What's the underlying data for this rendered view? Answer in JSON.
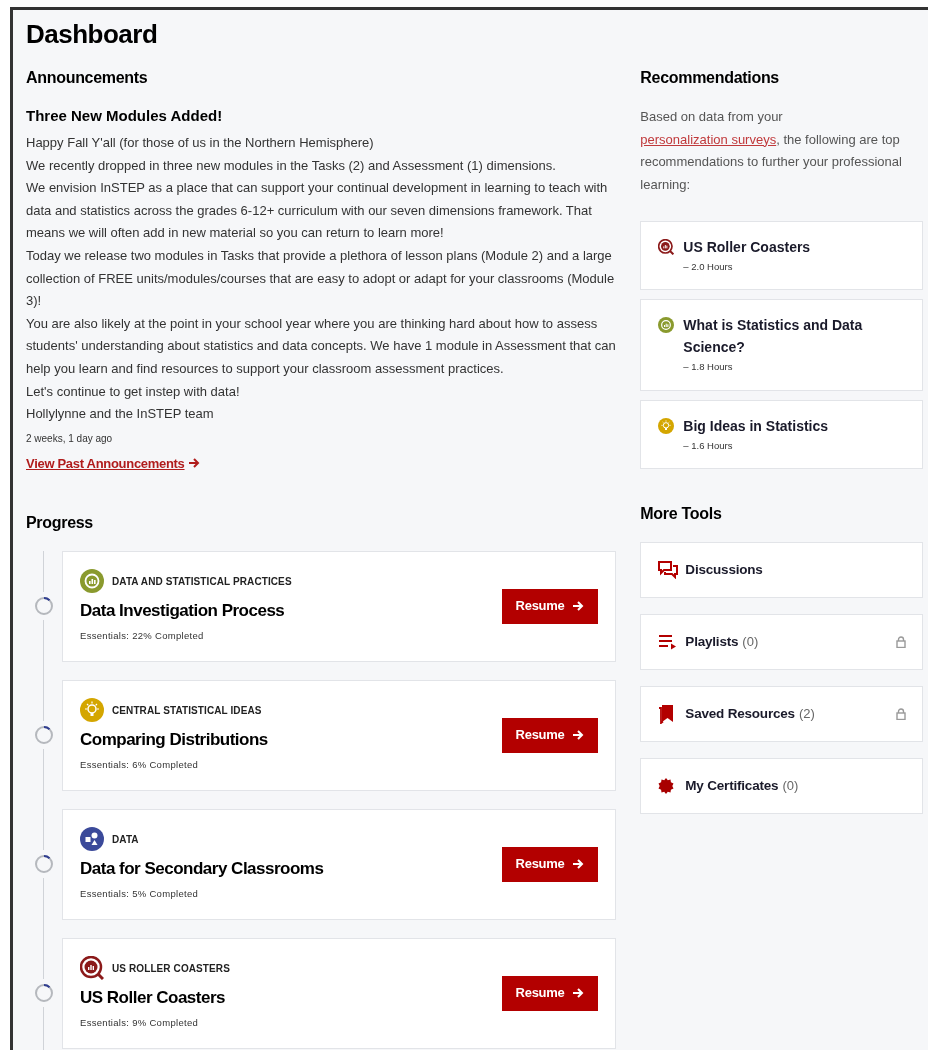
{
  "page_title": "Dashboard",
  "announcements": {
    "heading": "Announcements",
    "title": "Three New Modules Added!",
    "lines": [
      "Happy Fall Y'all (for those of us in the Northern Hemisphere)",
      "We recently dropped in three new modules in the Tasks (2) and Assessment (1) dimensions.",
      "We envision InSTEP as a place that can support your continual development in learning to teach with data and statistics across the grades 6-12+ curriculum with our seven dimensions framework. That means we will often add in new material so you can return to learn more!",
      "Today we release two modules in Tasks that provide a plethora of lesson plans (Module 2) and a large collection of FREE units/modules/courses that are easy to adopt or adapt for your classrooms (Module 3)!",
      "You are also likely at the point in your school year where you are thinking hard about how to assess students' understanding about statistics and data concepts. We have 1 module in Assessment that can help you learn and find resources to support your classroom assessment practices.",
      "Let's continue to get instep with data!",
      "Hollylynne and the InSTEP team"
    ],
    "time": "2 weeks, 1 day ago",
    "link": "View Past Announcements"
  },
  "progress": {
    "heading": "Progress",
    "items": [
      {
        "kind": "chart",
        "color": "#8a9a2e",
        "category": "DATA AND STATISTICAL PRACTICES",
        "title": "Data Investigation Process",
        "status": "Essentials: 22% Completed",
        "button": "Resume"
      },
      {
        "kind": "bulb",
        "color": "#d4a600",
        "category": "CENTRAL STATISTICAL IDEAS",
        "title": "Comparing Distributions",
        "status": "Essentials: 6% Completed",
        "button": "Resume"
      },
      {
        "kind": "shapes",
        "color": "#3b4a9a",
        "category": "DATA",
        "title": "Data for Secondary Classrooms",
        "status": "Essentials: 5% Completed",
        "button": "Resume"
      },
      {
        "kind": "magnifier",
        "color": "#8b1a1a",
        "category": "US ROLLER COASTERS",
        "title": "US Roller Coasters",
        "status": "Essentials: 9% Completed",
        "button": "Resume"
      }
    ]
  },
  "recommendations": {
    "heading": "Recommendations",
    "intro_before": "Based on data from your",
    "intro_link": "personalization surveys",
    "intro_after": ", the following are top recommendations to further your professional learning:",
    "items": [
      {
        "kind": "magnifier",
        "color": "#8b1a1a",
        "title": "US Roller Coasters",
        "duration": "– 2.0 Hours"
      },
      {
        "kind": "chart",
        "color": "#8a9a2e",
        "title": "What is Statistics and Data Science?",
        "duration": "– 1.8 Hours"
      },
      {
        "kind": "bulb",
        "color": "#d4a600",
        "title": "Big Ideas in Statistics",
        "duration": "– 1.6 Hours"
      }
    ]
  },
  "more_tools": {
    "heading": "More Tools",
    "items": [
      {
        "kind": "discussions",
        "label": "Discussions",
        "locked": false
      },
      {
        "kind": "playlist",
        "label": "Playlists",
        "count": "(0)",
        "locked": true
      },
      {
        "kind": "saved",
        "label": "Saved Resources",
        "count": "(2)",
        "locked": true
      },
      {
        "kind": "certificate",
        "label": "My Certificates",
        "count": "(0)",
        "locked": false
      }
    ]
  }
}
